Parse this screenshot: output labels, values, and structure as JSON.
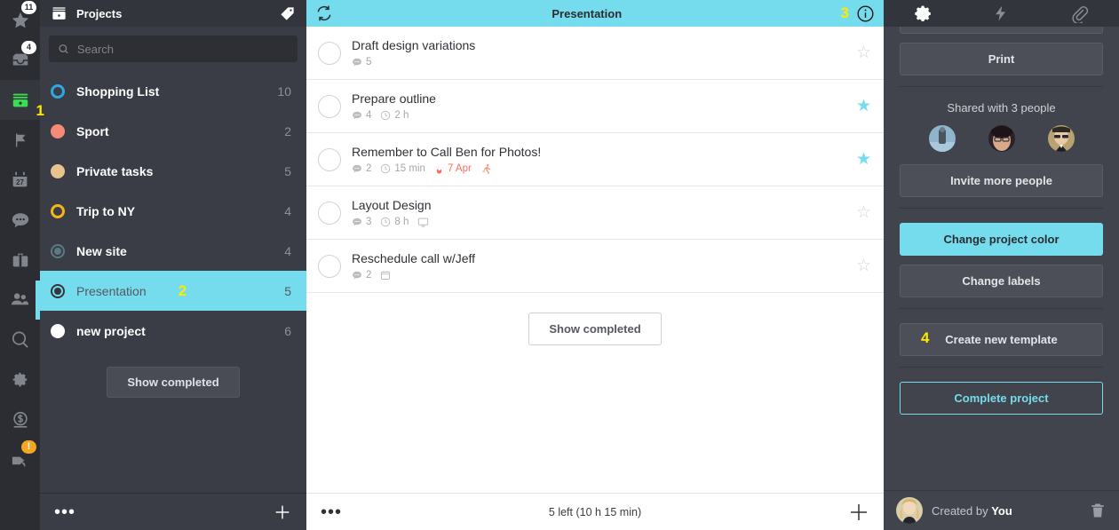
{
  "rail": {
    "items": [
      {
        "name": "star-icon",
        "badge": "11"
      },
      {
        "name": "inbox-icon",
        "badge": "4"
      },
      {
        "name": "wallet-icon",
        "badge": "",
        "annotation": "1"
      },
      {
        "name": "flag-icon",
        "badge": ""
      },
      {
        "name": "calendar-icon",
        "badge": "",
        "day": "27"
      },
      {
        "name": "chat-icon",
        "badge": ""
      },
      {
        "name": "briefcase-icon",
        "badge": ""
      },
      {
        "name": "people-icon",
        "badge": ""
      },
      {
        "name": "search-icon",
        "badge": ""
      },
      {
        "name": "gear-icon",
        "badge": ""
      },
      {
        "name": "dollar-icon",
        "badge": ""
      },
      {
        "name": "hand-pointer-icon",
        "badge": "!"
      }
    ]
  },
  "sidebar": {
    "title": "Projects",
    "tag_icon": "tag-icon",
    "search": {
      "placeholder": "Search",
      "value": ""
    },
    "projects": [
      {
        "label": "Shopping List",
        "count": "10",
        "color": "#2fa8e0",
        "style": "ring"
      },
      {
        "label": "Sport",
        "count": "2",
        "color": "#f58b77",
        "style": "solid"
      },
      {
        "label": "Private tasks",
        "count": "5",
        "color": "#e8c38e",
        "style": "solid"
      },
      {
        "label": "Trip to NY",
        "count": "4",
        "color": "#f5b418",
        "style": "ring"
      },
      {
        "label": "New site",
        "count": "4",
        "color": "#5c7a85",
        "style": "ring2"
      },
      {
        "label": "Presentation",
        "count": "5",
        "color": "#32353c",
        "style": "ring3",
        "selected": true,
        "annotation": "2"
      },
      {
        "label": "new project",
        "count": "6",
        "color": "#ffffff",
        "style": "solid"
      }
    ],
    "show_completed": "Show completed",
    "footer": {
      "more_icon": "ellipsis-icon",
      "add_icon": "plus-icon"
    }
  },
  "main": {
    "header": {
      "refresh_icon": "refresh-icon",
      "title": "Presentation",
      "info_icon": "info-icon",
      "annotation": "3"
    },
    "tasks": [
      {
        "title": "Draft design variations",
        "starred": false,
        "meta": [
          {
            "icon": "comment-icon",
            "text": "5"
          }
        ]
      },
      {
        "title": "Prepare outline",
        "starred": true,
        "meta": [
          {
            "icon": "comment-icon",
            "text": "4"
          },
          {
            "icon": "clock-icon",
            "text": "2 h"
          }
        ]
      },
      {
        "title": "Remember to Call Ben for Photos!",
        "starred": true,
        "meta": [
          {
            "icon": "comment-icon",
            "text": "2"
          },
          {
            "icon": "clock-icon",
            "text": "15 min"
          },
          {
            "icon": "fire-icon",
            "text": "7 Apr",
            "due": true
          },
          {
            "icon": "runner-icon",
            "text": ""
          }
        ]
      },
      {
        "title": "Layout Design",
        "starred": false,
        "meta": [
          {
            "icon": "comment-icon",
            "text": "3"
          },
          {
            "icon": "clock-icon",
            "text": "8 h"
          },
          {
            "icon": "monitor-icon",
            "text": ""
          }
        ]
      },
      {
        "title": "Reschedule call w/Jeff",
        "starred": false,
        "meta": [
          {
            "icon": "comment-icon",
            "text": "2"
          },
          {
            "icon": "calendar-icon",
            "text": ""
          }
        ]
      }
    ],
    "show_completed": "Show completed",
    "footer": {
      "more_icon": "ellipsis-icon",
      "status": "5 left (10 h 15 min)",
      "add_icon": "plus-icon"
    }
  },
  "right": {
    "tabs": [
      {
        "icon": "gear-icon",
        "active": true
      },
      {
        "icon": "lightning-icon",
        "active": false
      },
      {
        "icon": "paperclip-icon",
        "active": false
      }
    ],
    "print_label": "Print",
    "shared_label": "Shared with 3 people",
    "invite_label": "Invite more people",
    "change_color_label": "Change project color",
    "change_labels_label": "Change labels",
    "create_template_label": "Create new template",
    "create_template_annotation": "4",
    "complete_project_label": "Complete project",
    "created_by_prefix": "Created by ",
    "created_by_name": "You",
    "trash_icon": "trash-icon",
    "accent": "#75dced"
  }
}
